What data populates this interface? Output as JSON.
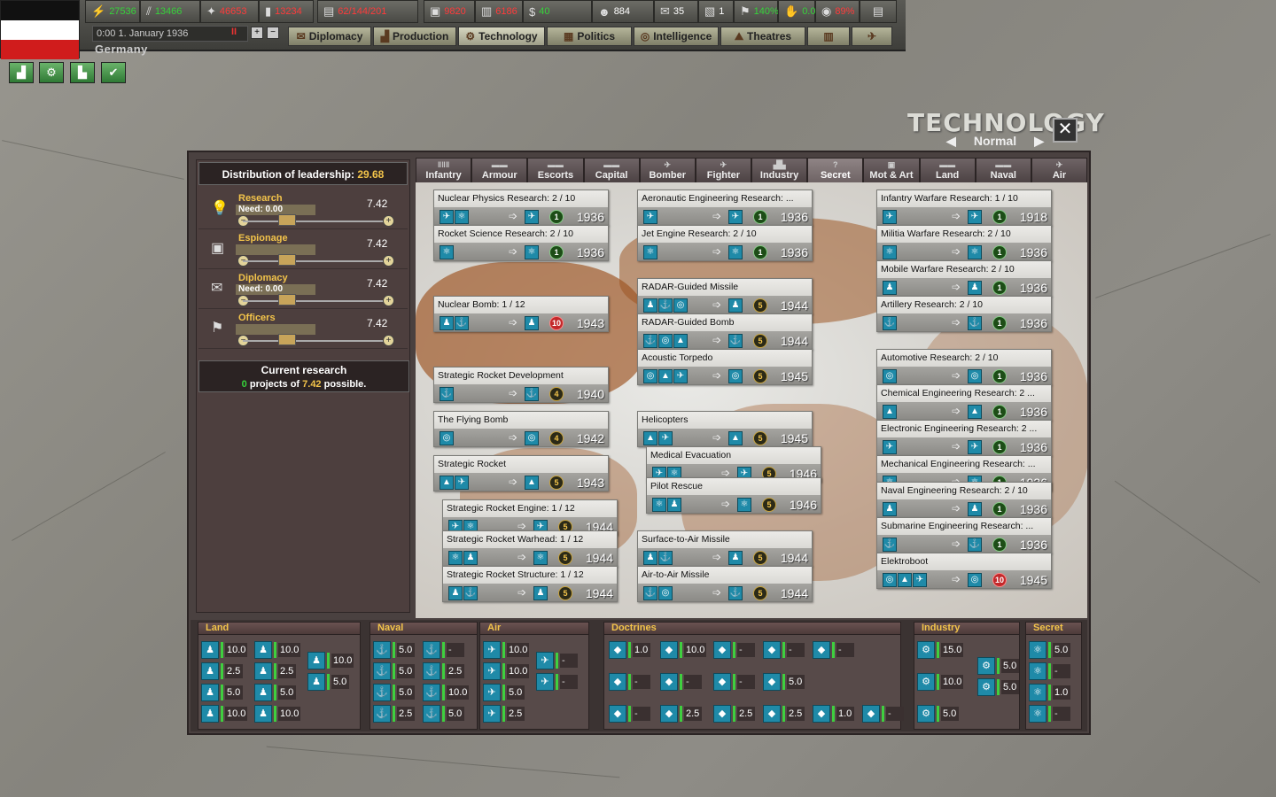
{
  "top": {
    "resources": [
      {
        "icon": "energy-icon",
        "value": "27536",
        "color": "green"
      },
      {
        "icon": "metal-icon",
        "value": "13466",
        "color": "green"
      },
      {
        "icon": "rare-materials-icon",
        "value": "46653",
        "color": "red"
      },
      {
        "icon": "oil-icon",
        "value": "13234",
        "color": "red"
      },
      {
        "icon": "ic-icon",
        "value": "62/144/201",
        "color": "red"
      },
      {
        "icon": "supplies-icon",
        "value": "9820",
        "color": "red"
      },
      {
        "icon": "fuel-icon",
        "value": "6186",
        "color": "red"
      },
      {
        "icon": "money-icon",
        "value": "40",
        "color": "green"
      },
      {
        "icon": "manpower-icon",
        "value": "884",
        "color": "white"
      },
      {
        "icon": "diplomacy-icon",
        "value": "35",
        "color": "white"
      },
      {
        "icon": "espionage-icon",
        "value": "1",
        "color": "white"
      },
      {
        "icon": "officers-icon",
        "value": "140%",
        "color": "green"
      },
      {
        "icon": "dissent-icon",
        "value": "0.00",
        "color": "green"
      },
      {
        "icon": "national-unity-icon",
        "value": "89%",
        "color": "red"
      }
    ],
    "date": "0:00 1. January 1936",
    "country": "Germany",
    "nav": [
      "Diplomacy",
      "Production",
      "Technology",
      "Politics",
      "Intelligence",
      "Theatres"
    ]
  },
  "title": {
    "main": "TECHNOLOGY",
    "mode": "Normal"
  },
  "left": {
    "distribution_label": "Distribution of leadership:",
    "distribution_value": "29.68",
    "sliders": [
      {
        "label": "Research",
        "need": "Need: 0.00",
        "value": "7.42"
      },
      {
        "label": "Espionage",
        "need": "",
        "value": "7.42"
      },
      {
        "label": "Diplomacy",
        "need": "Need: 0.00",
        "value": "7.42"
      },
      {
        "label": "Officers",
        "need": "",
        "value": "7.42"
      }
    ],
    "current_title": "Current research",
    "current_count": "0",
    "current_mid": " projects of ",
    "current_possible": "7.42",
    "current_end": " possible."
  },
  "tabs": [
    "Infantry",
    "Armour",
    "Escorts",
    "Capital",
    "Bomber",
    "Fighter",
    "Industry",
    "Secret",
    "Mot & Art",
    "Land",
    "Naval",
    "Air"
  ],
  "tab_icons": [
    "ǁǁǁ",
    "▬▬",
    "▬▬",
    "▬▬",
    "✈",
    "✈",
    "▟▙",
    "?",
    "▣",
    "▬▬",
    "▬▬",
    "✈"
  ],
  "cards_col1": [
    {
      "name": "Nuclear Physics Research: 2 / 10",
      "diff": "1",
      "year": "1936"
    },
    {
      "name": "Rocket Science Research: 2 / 10",
      "diff": "1",
      "year": "1936"
    },
    {
      "name": "Nuclear Bomb: 1 / 12",
      "diff": "10",
      "year": "1943"
    },
    {
      "name": "Strategic Rocket Development",
      "diff": "4",
      "year": "1940"
    },
    {
      "name": "The Flying Bomb",
      "diff": "4",
      "year": "1942"
    },
    {
      "name": "Strategic Rocket",
      "diff": "5",
      "year": "1943"
    },
    {
      "name": "Strategic Rocket Engine: 1 / 12",
      "diff": "5",
      "year": "1944"
    },
    {
      "name": "Strategic Rocket Warhead: 1 / 12",
      "diff": "5",
      "year": "1944"
    },
    {
      "name": "Strategic Rocket Structure: 1 / 12",
      "diff": "5",
      "year": "1944"
    }
  ],
  "cards_col2": [
    {
      "name": "Aeronautic Engineering Research: ...",
      "diff": "1",
      "year": "1936"
    },
    {
      "name": "Jet Engine Research: 2 / 10",
      "diff": "1",
      "year": "1936"
    },
    {
      "name": "RADAR-Guided Missile",
      "diff": "5",
      "year": "1944"
    },
    {
      "name": "RADAR-Guided Bomb",
      "diff": "5",
      "year": "1944"
    },
    {
      "name": "Acoustic Torpedo",
      "diff": "5",
      "year": "1945"
    },
    {
      "name": "Helicopters",
      "diff": "5",
      "year": "1945"
    },
    {
      "name": "Medical Evacuation",
      "diff": "5",
      "year": "1946"
    },
    {
      "name": "Pilot Rescue",
      "diff": "5",
      "year": "1946"
    },
    {
      "name": "Surface-to-Air Missile",
      "diff": "5",
      "year": "1944"
    },
    {
      "name": "Air-to-Air Missile",
      "diff": "5",
      "year": "1944"
    }
  ],
  "cards_col3": [
    {
      "name": "Infantry Warfare Research: 1 / 10",
      "diff": "1",
      "year": "1918"
    },
    {
      "name": "Militia Warfare Research: 2 / 10",
      "diff": "1",
      "year": "1936"
    },
    {
      "name": "Mobile Warfare Research: 2 / 10",
      "diff": "1",
      "year": "1936"
    },
    {
      "name": "Artillery Research: 2 / 10",
      "diff": "1",
      "year": "1936"
    },
    {
      "name": "Automotive Research: 2 / 10",
      "diff": "1",
      "year": "1936"
    },
    {
      "name": "Chemical Engineering Research: 2 ...",
      "diff": "1",
      "year": "1936"
    },
    {
      "name": "Electronic Engineering Research: 2 ...",
      "diff": "1",
      "year": "1936"
    },
    {
      "name": "Mechanical Engineering Research: ...",
      "diff": "1",
      "year": "1936"
    },
    {
      "name": "Naval Engineering Research: 2 / 10",
      "diff": "1",
      "year": "1936"
    },
    {
      "name": "Submarine Engineering Research: ...",
      "diff": "1",
      "year": "1936"
    },
    {
      "name": "Elektroboot",
      "diff": "10",
      "year": "1945"
    }
  ],
  "bottom": {
    "groups": [
      "Land",
      "Naval",
      "Air",
      "Doctrines",
      "Industry",
      "Secret"
    ],
    "land": [
      "10.0",
      "10.0",
      "2.5",
      "2.5",
      "10.0",
      "5.0",
      "5.0",
      "5.0",
      "10.0",
      "10.0"
    ],
    "naval": [
      "5.0",
      "-",
      "5.0",
      "2.5",
      "5.0",
      "10.0",
      "2.5",
      "5.0"
    ],
    "air": [
      "10.0",
      "-",
      "10.0",
      "-",
      "5.0",
      "2.5"
    ],
    "doctrines": [
      "1.0",
      "10.0",
      "-",
      "-",
      "-",
      "-",
      "-",
      "-",
      "5.0",
      "-",
      "2.5",
      "2.5",
      "2.5",
      "1.0",
      "-"
    ],
    "industry": [
      "15.0",
      "5.0",
      "10.0",
      "5.0",
      "5.0"
    ],
    "secret": [
      "5.0",
      "-",
      "1.0",
      "-"
    ]
  }
}
